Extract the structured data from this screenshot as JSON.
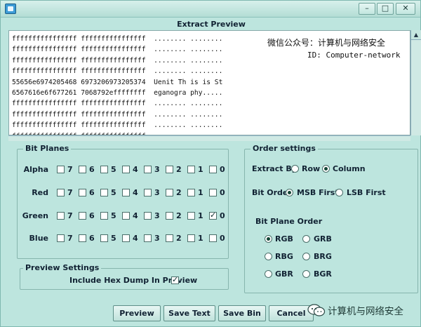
{
  "window": {
    "title": "Extract Preview"
  },
  "preview": {
    "lines": [
      "ffffffffffffffff ffffffffffffffff  ........ ........",
      "ffffffffffffffff ffffffffffffffff  ........ ........",
      "ffffffffffffffff ffffffffffffffff  ........ ........",
      "ffffffffffffffff ffffffffffffffff  ........ ........",
      "55656e6974205468 6973206973205374  Uenit Th is is St",
      "6567616e6f677261 7068792effffffff  eganogra phy.....",
      "ffffffffffffffff ffffffffffffffff  ........ ........",
      "ffffffffffffffff ffffffffffffffff  ........ ........",
      "ffffffffffffffff ffffffffffffffff  ........ ........",
      "ffffffffffffffff ffffffffffffffff  ........ ........"
    ],
    "overlay_line1": "微信公众号：计算机与网络安全",
    "overlay_line2": "ID: Computer-network"
  },
  "bit_planes": {
    "legend": "Bit Planes",
    "bits": [
      "7",
      "6",
      "5",
      "4",
      "3",
      "2",
      "1",
      "0"
    ],
    "rows": [
      {
        "label": "Alpha",
        "checked": [
          false,
          false,
          false,
          false,
          false,
          false,
          false,
          false
        ]
      },
      {
        "label": "Red",
        "checked": [
          false,
          false,
          false,
          false,
          false,
          false,
          false,
          false
        ]
      },
      {
        "label": "Green",
        "checked": [
          false,
          false,
          false,
          false,
          false,
          false,
          false,
          true
        ]
      },
      {
        "label": "Blue",
        "checked": [
          false,
          false,
          false,
          false,
          false,
          false,
          false,
          false
        ]
      }
    ]
  },
  "order_settings": {
    "legend": "Order settings",
    "extract_by_label": "Extract By",
    "extract_by_options": [
      {
        "label": "Row",
        "selected": false
      },
      {
        "label": "Column",
        "selected": true
      }
    ],
    "bit_order_label": "Bit Order",
    "bit_order_options": [
      {
        "label": "MSB First",
        "selected": true
      },
      {
        "label": "LSB First",
        "selected": false
      }
    ],
    "bit_plane_order_label": "Bit Plane Order",
    "bit_plane_order_options": [
      {
        "label": "RGB",
        "selected": true
      },
      {
        "label": "GRB",
        "selected": false
      },
      {
        "label": "RBG",
        "selected": false
      },
      {
        "label": "BRG",
        "selected": false
      },
      {
        "label": "GBR",
        "selected": false
      },
      {
        "label": "BGR",
        "selected": false
      }
    ]
  },
  "preview_settings": {
    "legend": "Preview Settings",
    "hex_dump_label": "Include Hex Dump In Preview",
    "hex_dump_checked": true
  },
  "buttons": {
    "preview": "Preview",
    "save_text": "Save Text",
    "save_bin": "Save Bin",
    "cancel": "Cancel"
  },
  "watermark": {
    "text": "计算机与网络安全"
  }
}
